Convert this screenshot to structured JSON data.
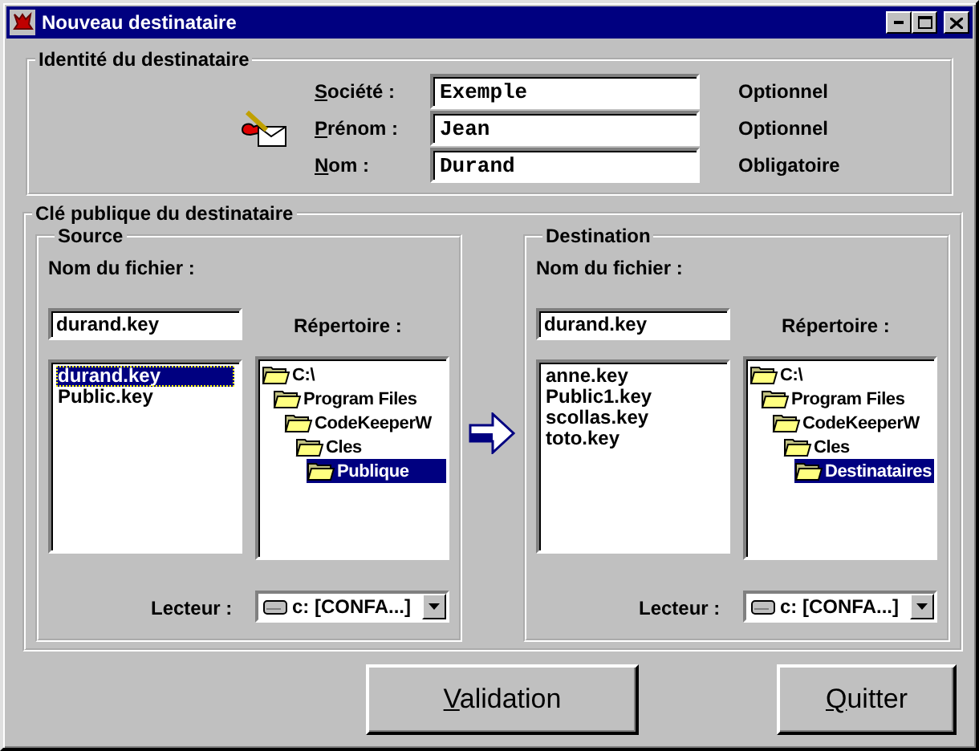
{
  "window": {
    "title": "Nouveau destinataire"
  },
  "identity": {
    "title": "Identité du destinataire",
    "fields": [
      {
        "label": "Société :",
        "value": "Exemple",
        "note": "Optionnel"
      },
      {
        "label": "Prénom :",
        "value": "Jean",
        "note": "Optionnel"
      },
      {
        "label": "Nom :",
        "value": "Durand",
        "note": "Obligatoire"
      }
    ]
  },
  "key_group": {
    "title": "Clé publique du destinataire",
    "panels": [
      {
        "title": "Source",
        "filename_label": "Nom du fichier :",
        "filename": "durand.key",
        "directory_label": "Répertoire :",
        "files": [
          {
            "name": "durand.key",
            "selected": true
          },
          {
            "name": "Public.key",
            "selected": false
          }
        ],
        "tree": [
          {
            "name": "C:\\",
            "selected": false,
            "children": [
              {
                "name": "Program Files",
                "selected": false,
                "children": [
                  {
                    "name": "CodeKeeperW",
                    "selected": false,
                    "children": [
                      {
                        "name": "Cles",
                        "selected": false,
                        "children": [
                          {
                            "name": "Publique",
                            "selected": true
                          }
                        ]
                      }
                    ]
                  }
                ]
              }
            ]
          }
        ],
        "drive_label": "Lecteur :",
        "drive": "c: [CONFA...]"
      },
      {
        "title": "Destination",
        "filename_label": "Nom du fichier :",
        "filename": "durand.key",
        "directory_label": "Répertoire :",
        "files": [
          {
            "name": "anne.key",
            "selected": false
          },
          {
            "name": "Public1.key",
            "selected": false
          },
          {
            "name": "scollas.key",
            "selected": false
          },
          {
            "name": "toto.key",
            "selected": false
          }
        ],
        "tree": [
          {
            "name": "C:\\",
            "selected": false,
            "children": [
              {
                "name": "Program Files",
                "selected": false,
                "children": [
                  {
                    "name": "CodeKeeperW",
                    "selected": false,
                    "children": [
                      {
                        "name": "Cles",
                        "selected": false,
                        "children": [
                          {
                            "name": "Destinataires",
                            "selected": true
                          }
                        ]
                      }
                    ]
                  }
                ]
              }
            ]
          }
        ],
        "drive_label": "Lecteur :",
        "drive": "c: [CONFA...]"
      }
    ]
  },
  "buttons": [
    {
      "label": "Validation"
    },
    {
      "label": "Quitter"
    }
  ]
}
